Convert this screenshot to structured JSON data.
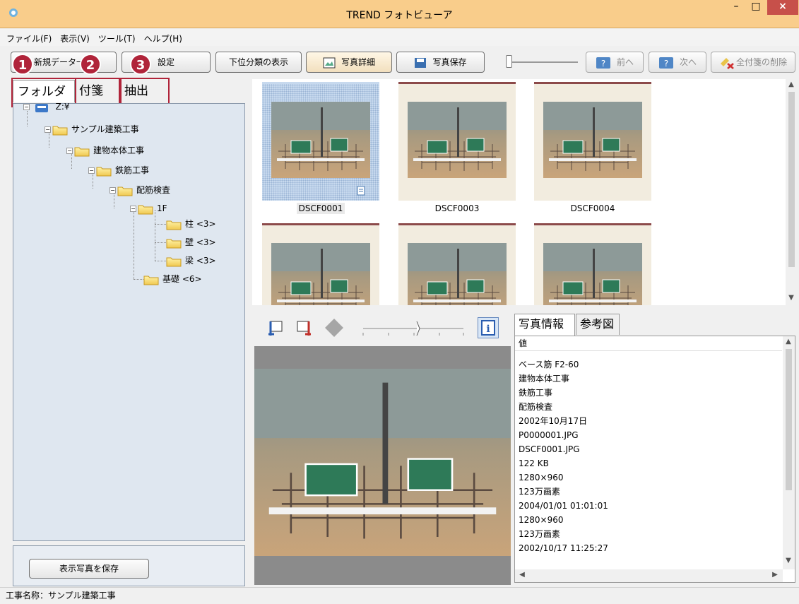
{
  "window": {
    "title": "TREND フォトビューア",
    "minimize": "–",
    "maximize": "□",
    "close": "×"
  },
  "menu": [
    "ファイル(F)",
    "表示(V)",
    "ツール(T)",
    "ヘルプ(H)"
  ],
  "toolbar": {
    "new_data": "新規データ一覧",
    "settings": "設定",
    "show_sub": "下位分類の表示",
    "photo_detail": "写真詳細",
    "photo_save": "写真保存",
    "prev": "前へ",
    "next": "次へ",
    "delete_tags": "全付箋の削除"
  },
  "markers": [
    "1",
    "2",
    "3"
  ],
  "left_tabs": [
    "フォルダ",
    "付箋",
    "抽出"
  ],
  "tree": {
    "root": "Z:¥",
    "project": "サンプル建築工事",
    "building": "建物本体工事",
    "rebar": "鉄筋工事",
    "inspection": "配筋検査",
    "floor": "1F",
    "col": "柱 <3>",
    "wall": "壁 <3>",
    "beam": "梁 <3>",
    "foundation": "基礎 <6>"
  },
  "save_button": "表示写真を保存",
  "thumbnails": [
    "DSCF0001",
    "DSCF0003",
    "DSCF0004"
  ],
  "info_tabs": [
    "写真情報",
    "参考図"
  ],
  "info": {
    "header": "値",
    "rows": [
      "ベース筋 F2-60",
      "建物本体工事",
      "鉄筋工事",
      "配筋検査",
      "2002年10月17日",
      "P0000001.JPG",
      "DSCF0001.JPG",
      "122 KB",
      "1280×960",
      "123万画素",
      "2004/01/01 01:01:01",
      "1280×960",
      "123万画素",
      "2002/10/17 11:25:27"
    ]
  },
  "status": "工事名称：サンプル建築工事",
  "colors": {
    "marker": "#b0243a",
    "titlebar": "#f9cd8b",
    "close": "#c7504a"
  }
}
